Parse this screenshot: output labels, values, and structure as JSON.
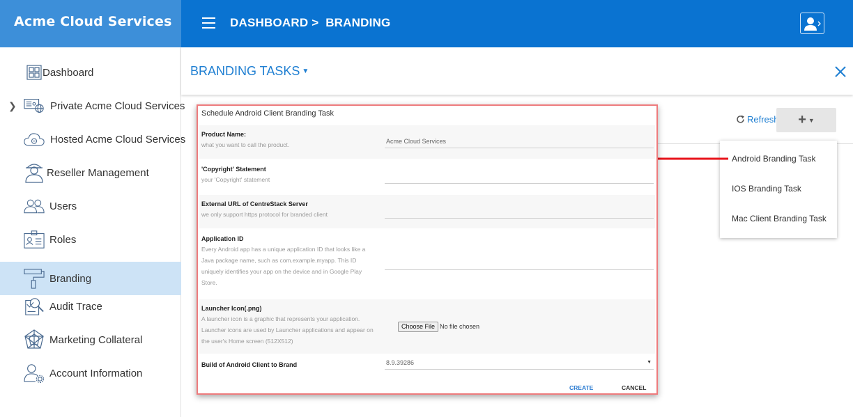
{
  "app": {
    "title": "Acme Cloud Services"
  },
  "header": {
    "breadcrumb": "DASHBOARD >  BRANDING"
  },
  "sidebar": {
    "items": [
      {
        "label": "Dashboard",
        "icon": "dashboard-grid-icon"
      },
      {
        "label": "Private Acme Cloud Services",
        "icon": "server-globe-icon",
        "expandable": true
      },
      {
        "label": "Hosted Acme Cloud Services",
        "icon": "cloud-icon"
      },
      {
        "label": "Reseller Management",
        "icon": "reseller-person-icon"
      },
      {
        "label": "Users",
        "icon": "users-icon"
      },
      {
        "label": "Roles",
        "icon": "id-card-icon"
      },
      {
        "label": "Branding",
        "icon": "paint-roller-icon",
        "active": true
      },
      {
        "label": "Audit Trace",
        "icon": "audit-magnifier-icon"
      },
      {
        "label": "Marketing Collateral",
        "icon": "web-network-icon"
      },
      {
        "label": "Account Information",
        "icon": "account-gear-icon"
      }
    ]
  },
  "panel": {
    "title": "BRANDING TASKS"
  },
  "toolbar": {
    "refresh_label": "Refresh",
    "add_label": "+"
  },
  "menu": {
    "items": [
      "Android Branding Task",
      "IOS Branding Task",
      "Mac Client Branding Task"
    ]
  },
  "dialog": {
    "title": "Schedule Android Client Branding Task",
    "fields": {
      "product_name": {
        "label": "Product Name:",
        "desc": "what you want to call the product.",
        "value": "Acme Cloud Services"
      },
      "copyright": {
        "label": "'Copyright' Statement",
        "desc": "your 'Copyright' statement",
        "value": ""
      },
      "external_url": {
        "label": "External URL of CentreStack Server",
        "desc": "we only support https protocol for branded client",
        "value": ""
      },
      "application_id": {
        "label": "Application ID",
        "desc": [
          "Every Android app has a unique application ID that looks like a",
          "Java package name, such as com.example.myapp. This ID",
          "uniquely identifies your app on the device and in Google Play",
          "Store."
        ],
        "value": ""
      },
      "launcher_icon": {
        "label": "Launcher Icon(.png)",
        "desc": [
          "A launcher icon is a graphic that represents your application.",
          "Launcher icons are used by Launcher applications and appear on",
          "the user's Home screen (512X512)"
        ],
        "button": "Choose File",
        "status": "No file chosen"
      },
      "build": {
        "label": "Build of Android Client to Brand",
        "value": "8.9.39286"
      }
    },
    "create_label": "CREATE",
    "cancel_label": "CANCEL"
  },
  "colors": {
    "brand_bar": "#3d8fd9",
    "top_bar": "#0a73d1",
    "active_item": "#cde3f6",
    "accent": "#1f7fd2",
    "dialog_border": "#ee7b7d",
    "arrow": "#e8141b"
  }
}
